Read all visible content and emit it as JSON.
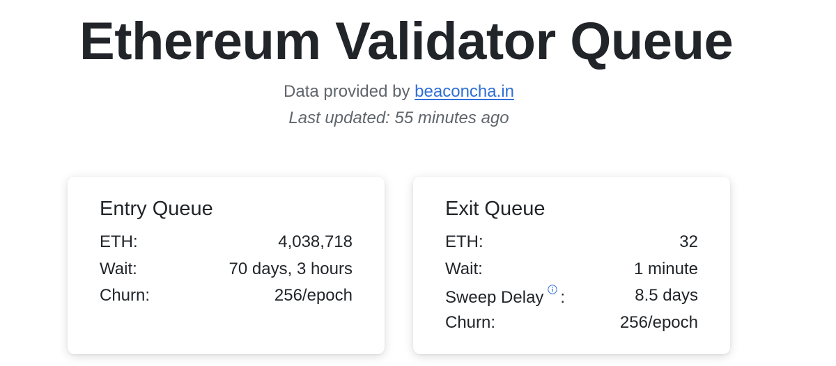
{
  "page": {
    "title": "Ethereum Validator Queue",
    "provided_prefix": "Data provided by",
    "provider_link": "beaconcha.in",
    "last_updated": "Last updated: 55 minutes ago"
  },
  "entry_queue": {
    "title": "Entry Queue",
    "rows": [
      {
        "label": "ETH:",
        "value": "4,038,718"
      },
      {
        "label": "Wait:",
        "value": "70 days, 3 hours"
      },
      {
        "label": "Churn:",
        "value": "256/epoch"
      }
    ]
  },
  "exit_queue": {
    "title": "Exit Queue",
    "rows": [
      {
        "label": "ETH:",
        "value": "32"
      },
      {
        "label": "Wait:",
        "value": "1 minute"
      },
      {
        "label": "Sweep Delay",
        "suffix": ":",
        "value": "8.5 days",
        "icon": "info-icon"
      },
      {
        "label": "Churn:",
        "value": "256/epoch"
      }
    ]
  },
  "colors": {
    "text": "#212529",
    "muted": "#5f656b",
    "link": "#2f6fd6"
  }
}
